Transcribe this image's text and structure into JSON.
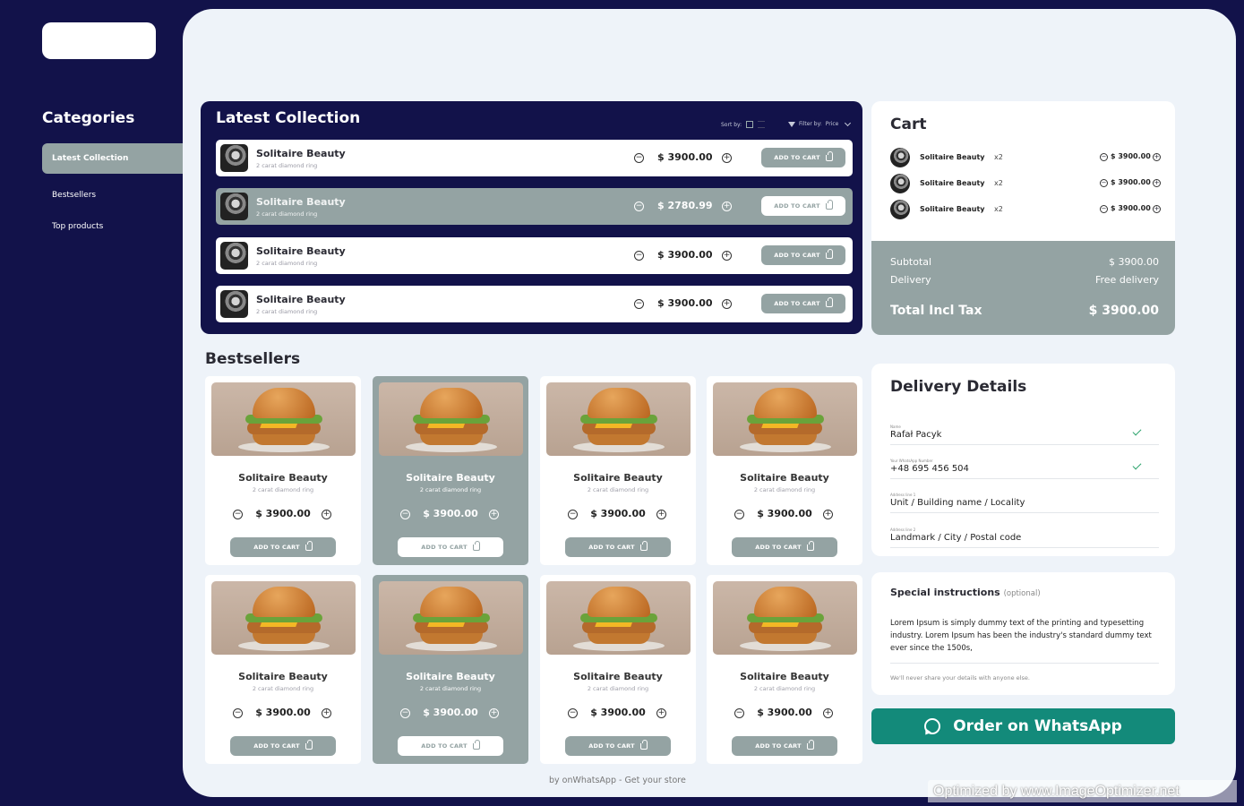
{
  "sidebar": {
    "title": "Categories",
    "items": [
      {
        "label": "Latest Collection"
      },
      {
        "label": "Bestsellers"
      },
      {
        "label": "Top products"
      }
    ]
  },
  "latest": {
    "title": "Latest Collection",
    "sort_label": "Sort by:",
    "filter_label": "Filter by:",
    "filter_value": "Price",
    "products": [
      {
        "name": "Solitaire Beauty",
        "sub": "2 carat diamond ring",
        "price": "$ 3900.00",
        "button": "ADD TO CART"
      },
      {
        "name": "Solitaire Beauty",
        "sub": "2 carat diamond ring",
        "price": "$ 2780.99",
        "button": "ADD TO CART"
      },
      {
        "name": "Solitaire Beauty",
        "sub": "2 carat diamond ring",
        "price": "$ 3900.00",
        "button": "ADD TO CART"
      },
      {
        "name": "Solitaire Beauty",
        "sub": "2 carat diamond ring",
        "price": "$ 3900.00",
        "button": "ADD TO CART"
      }
    ]
  },
  "bestsellers": {
    "title": "Bestsellers",
    "cards": [
      {
        "name": "Solitaire Beauty",
        "sub": "2 carat diamond ring",
        "price": "$ 3900.00",
        "button": "ADD TO CART"
      },
      {
        "name": "Solitaire Beauty",
        "sub": "2 carat diamond ring",
        "price": "$ 3900.00",
        "button": "ADD TO CART"
      },
      {
        "name": "Solitaire Beauty",
        "sub": "2 carat diamond ring",
        "price": "$ 3900.00",
        "button": "ADD TO CART"
      },
      {
        "name": "Solitaire Beauty",
        "sub": "2 carat diamond ring",
        "price": "$ 3900.00",
        "button": "ADD TO CART"
      },
      {
        "name": "Solitaire Beauty",
        "sub": "2 carat diamond ring",
        "price": "$ 3900.00",
        "button": "ADD TO CART"
      },
      {
        "name": "Solitaire Beauty",
        "sub": "2 carat diamond ring",
        "price": "$ 3900.00",
        "button": "ADD TO CART"
      },
      {
        "name": "Solitaire Beauty",
        "sub": "2 carat diamond ring",
        "price": "$ 3900.00",
        "button": "ADD TO CART"
      },
      {
        "name": "Solitaire Beauty",
        "sub": "2 carat diamond ring",
        "price": "$ 3900.00",
        "button": "ADD TO CART"
      }
    ]
  },
  "footer": {
    "note": "by onWhatsApp - Get your store"
  },
  "cart": {
    "title": "Cart",
    "items": [
      {
        "name": "Solitaire Beauty",
        "qty": "x2",
        "price": "$ 3900.00"
      },
      {
        "name": "Solitaire Beauty",
        "qty": "x2",
        "price": "$ 3900.00"
      },
      {
        "name": "Solitaire Beauty",
        "qty": "x2",
        "price": "$ 3900.00"
      }
    ],
    "subtotal_label": "Subtotal",
    "subtotal_value": "$ 3900.00",
    "delivery_label": "Delivery",
    "delivery_value": "Free delivery",
    "total_label": "Total Incl Tax",
    "total_value": "$ 3900.00"
  },
  "delivery": {
    "title": "Delivery Details",
    "fields": [
      {
        "label": "Name",
        "value": "Rafał Pacyk"
      },
      {
        "label": "Your WhatsApp Number",
        "value": "+48 695 456 504"
      },
      {
        "label": "Address line 1",
        "value": "Unit / Building name / Locality"
      },
      {
        "label": "Address line 2",
        "value": "Landmark / City / Postal code"
      }
    ]
  },
  "special": {
    "title": "Special instructions",
    "optional": "(optional)",
    "text": "Lorem Ipsum is simply dummy text of the printing and typesetting industry. Lorem Ipsum has been the industry's standard dummy text ever since the 1500s,",
    "note": "We'll never share your details with anyone else."
  },
  "order_button": {
    "label": "Order on WhatsApp"
  },
  "watermark": {
    "text": "Optimized by www.ImageOptimizer.net"
  },
  "colors": {
    "navy": "#12124a",
    "accent": "#94a3a3",
    "whatsapp": "#138a7a",
    "page": "#eef3f9"
  }
}
